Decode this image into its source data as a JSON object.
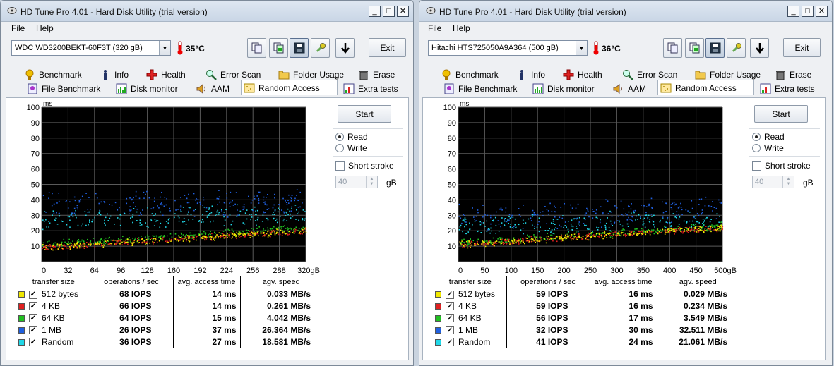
{
  "windows": [
    {
      "title": "HD Tune Pro 4.01 - Hard Disk Utility (trial version)",
      "menu": [
        "File",
        "Help"
      ],
      "drive": "WDC WD3200BEKT-60F3T    (320 gB)",
      "temperature": "35°C",
      "exit_label": "Exit",
      "tabs_row1": [
        "Benchmark",
        "Info",
        "Health",
        "Error Scan",
        "Folder Usage",
        "Erase"
      ],
      "tabs_row2": [
        "File Benchmark",
        "Disk monitor",
        "AAM",
        "Random Access",
        "Extra tests"
      ],
      "selected_tab": "Random Access",
      "start_label": "Start",
      "read_label": "Read",
      "write_label": "Write",
      "read_selected": true,
      "short_stroke_label": "Short stroke",
      "short_stroke_value": "40",
      "gb_label": "gB",
      "table_headers": [
        "transfer size",
        "operations / sec",
        "avg. access time",
        "agv. speed"
      ],
      "rows": [
        {
          "color": "#f0e800",
          "size": "512 bytes",
          "iops": "68 IOPS",
          "time": "14 ms",
          "speed": "0.033 MB/s"
        },
        {
          "color": "#e02020",
          "size": "4 KB",
          "iops": "66 IOPS",
          "time": "14 ms",
          "speed": "0.261 MB/s"
        },
        {
          "color": "#20c020",
          "size": "64 KB",
          "iops": "64 IOPS",
          "time": "15 ms",
          "speed": "4.042 MB/s"
        },
        {
          "color": "#2060e0",
          "size": "1 MB",
          "iops": "26 IOPS",
          "time": "37 ms",
          "speed": "26.364 MB/s"
        },
        {
          "color": "#20d8e8",
          "size": "Random",
          "iops": "36 IOPS",
          "time": "27 ms",
          "speed": "18.581 MB/s"
        }
      ]
    },
    {
      "title": "HD Tune Pro 4.01 - Hard Disk Utility (trial version)",
      "menu": [
        "File",
        "Help"
      ],
      "drive": "Hitachi HTS725050A9A364 (500 gB)",
      "temperature": "36°C",
      "exit_label": "Exit",
      "tabs_row1": [
        "Benchmark",
        "Info",
        "Health",
        "Error Scan",
        "Folder Usage",
        "Erase"
      ],
      "tabs_row2": [
        "File Benchmark",
        "Disk monitor",
        "AAM",
        "Random Access",
        "Extra tests"
      ],
      "selected_tab": "Random Access",
      "start_label": "Start",
      "read_label": "Read",
      "write_label": "Write",
      "read_selected": true,
      "short_stroke_label": "Short stroke",
      "short_stroke_value": "40",
      "gb_label": "gB",
      "table_headers": [
        "transfer size",
        "operations / sec",
        "avg. access time",
        "agv. speed"
      ],
      "rows": [
        {
          "color": "#f0e800",
          "size": "512 bytes",
          "iops": "59 IOPS",
          "time": "16 ms",
          "speed": "0.029 MB/s"
        },
        {
          "color": "#e02020",
          "size": "4 KB",
          "iops": "59 IOPS",
          "time": "16 ms",
          "speed": "0.234 MB/s"
        },
        {
          "color": "#20c020",
          "size": "64 KB",
          "iops": "56 IOPS",
          "time": "17 ms",
          "speed": "3.549 MB/s"
        },
        {
          "color": "#2060e0",
          "size": "1 MB",
          "iops": "32 IOPS",
          "time": "30 ms",
          "speed": "32.511 MB/s"
        },
        {
          "color": "#20d8e8",
          "size": "Random",
          "iops": "41 IOPS",
          "time": "24 ms",
          "speed": "21.061 MB/s"
        }
      ]
    }
  ],
  "chart_data": [
    {
      "type": "scatter",
      "ylabel": "ms",
      "ylim": [
        0,
        100
      ],
      "y_ticks": [
        "100",
        "90",
        "80",
        "70",
        "60",
        "50",
        "40",
        "30",
        "20",
        "10"
      ],
      "xlim": [
        0,
        320
      ],
      "x_ticks": [
        "0",
        "32",
        "64",
        "96",
        "128",
        "160",
        "192",
        "224",
        "256",
        "288",
        "320gB"
      ],
      "background": "#000000",
      "grid": true,
      "series": [
        {
          "name": "512 bytes",
          "color": "#f0e800",
          "trend": [
            [
              0,
              9
            ],
            [
              320,
              20
            ]
          ]
        },
        {
          "name": "4 KB",
          "color": "#e02020",
          "trend": [
            [
              0,
              9
            ],
            [
              320,
              20
            ]
          ]
        },
        {
          "name": "64 KB",
          "color": "#20c020",
          "trend": [
            [
              0,
              11
            ],
            [
              320,
              22
            ]
          ]
        },
        {
          "name": "1 MB",
          "color": "#2060e0",
          "trend": [
            [
              0,
              35
            ],
            [
              320,
              38
            ]
          ]
        },
        {
          "name": "Random",
          "color": "#20d8e8",
          "trend": [
            [
              0,
              26
            ],
            [
              320,
              30
            ]
          ]
        }
      ]
    },
    {
      "type": "scatter",
      "ylabel": "ms",
      "ylim": [
        0,
        100
      ],
      "y_ticks": [
        "100",
        "90",
        "80",
        "70",
        "60",
        "50",
        "40",
        "30",
        "20",
        "10"
      ],
      "xlim": [
        0,
        500
      ],
      "x_ticks": [
        "0",
        "50",
        "100",
        "150",
        "200",
        "250",
        "300",
        "350",
        "400",
        "450",
        "500gB"
      ],
      "background": "#000000",
      "grid": true,
      "series": [
        {
          "name": "512 bytes",
          "color": "#f0e800",
          "trend": [
            [
              0,
              11
            ],
            [
              500,
              22
            ]
          ]
        },
        {
          "name": "4 KB",
          "color": "#e02020",
          "trend": [
            [
              0,
              11
            ],
            [
              500,
              22
            ]
          ]
        },
        {
          "name": "64 KB",
          "color": "#20c020",
          "trend": [
            [
              0,
              12
            ],
            [
              500,
              23
            ]
          ]
        },
        {
          "name": "1 MB",
          "color": "#2060e0",
          "trend": [
            [
              0,
              27
            ],
            [
              500,
              33
            ]
          ]
        },
        {
          "name": "Random",
          "color": "#20d8e8",
          "trend": [
            [
              0,
              22
            ],
            [
              500,
              27
            ]
          ]
        }
      ]
    }
  ]
}
